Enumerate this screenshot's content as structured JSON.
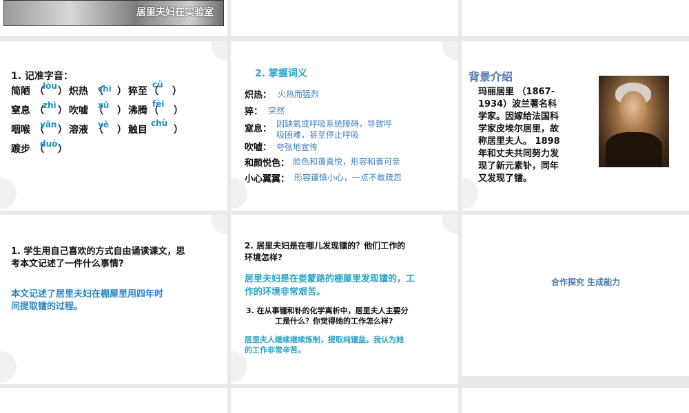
{
  "top": {
    "photo_caption": "居里夫妇在实验室"
  },
  "slide_pronunciation": {
    "heading": "1. 记准字音：",
    "rows": [
      [
        {
          "word": "简陋",
          "pinyin": "lòu"
        },
        {
          "word": "炽热",
          "pinyin": "chì"
        },
        {
          "word": "猝至",
          "pinyin": "cù"
        }
      ],
      [
        {
          "word": "窒息",
          "pinyin": "zhì"
        },
        {
          "word": "吹嘘",
          "pinyin": "xū"
        },
        {
          "word": "沸腾",
          "pinyin": "fèi"
        }
      ],
      [
        {
          "word": "咽喉",
          "pinyin": "yān"
        },
        {
          "word": "溶液",
          "pinyin": "yè"
        },
        {
          "word": "触目",
          "pinyin": "chù"
        }
      ],
      [
        {
          "word": "踱步",
          "pinyin": "duò"
        }
      ]
    ]
  },
  "slide_vocab": {
    "heading": "2. 掌握词义",
    "items": [
      {
        "term": "炽热：",
        "meaning": "火热而猛烈"
      },
      {
        "term": "猝：",
        "meaning": "突然"
      },
      {
        "term": "窒息：",
        "meaning": "因缺氧或呼吸系统障碍，导致呼",
        "meaning2": "吸困难，甚至停止呼吸"
      },
      {
        "term": "吹嘘：",
        "meaning": "夸张地宣传"
      },
      {
        "term": "和颜悦色：",
        "meaning": "脸色和蔼喜悦，形容和善可亲"
      },
      {
        "term": "小心翼翼：",
        "meaning": "形容谨慎小心，一点不敢疏忽"
      }
    ]
  },
  "slide_background": {
    "heading": "背景介绍",
    "lines": [
      "玛丽居里 （1867-",
      "1934）波兰著名科",
      "学家。因嫁给法国科",
      "学家皮埃尔居里，故",
      "称居里夫人。 1898",
      "年和丈夫共同努力发",
      "现了新元素钋，同年",
      "又发现了镭。"
    ]
  },
  "slide_q1": {
    "question_line1": "1. 学生用自己喜欢的方式自由诵读课文，思",
    "question_line2": "考本文记述了一件什么事情?",
    "answer_line1": "本文记述了居里夫妇在棚屋里用四年时",
    "answer_line2": "间提取镭的过程。"
  },
  "slide_q2": {
    "question_line1": "2. 居里夫妇是在哪儿发现镭的？他们工作的",
    "question_line2": "环境怎样?",
    "answer_line1": "居里夫妇是在娄蒙路的棚屋里发现镭的，工",
    "answer_line2": "作的环境非常艰苦。",
    "q3_line1": "3. 在从事镭和钋的化学离析中，居里夫人主要分",
    "q3_line2": "工是什么？你觉得她的工作怎么样?",
    "a3_line1": "居里夫人继续继续炼制，提取纯镭盐。我认为她",
    "a3_line2": "的工作非常辛苦。"
  },
  "slide_section": {
    "title": "合作探究 生成能力"
  }
}
